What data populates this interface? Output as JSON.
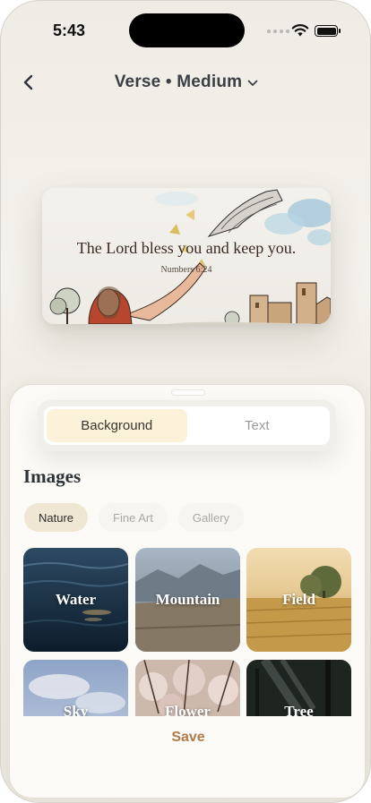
{
  "status_bar": {
    "time": "5:43"
  },
  "nav": {
    "title": "Verse • Medium",
    "back_icon": "chevron-left-icon",
    "dropdown_icon": "chevron-down-icon"
  },
  "preview": {
    "verse": "The Lord bless you and keep you.",
    "reference": "Numbers 6:24"
  },
  "sheet": {
    "tabs": [
      {
        "label": "Background",
        "active": true
      },
      {
        "label": "Text",
        "active": false
      }
    ],
    "section_title": "Images",
    "chips": [
      {
        "label": "Nature",
        "active": true
      },
      {
        "label": "Fine Art",
        "active": false
      },
      {
        "label": "Gallery",
        "active": false
      }
    ],
    "images": [
      {
        "label": "Water"
      },
      {
        "label": "Mountain"
      },
      {
        "label": "Field"
      },
      {
        "label": "Sky"
      },
      {
        "label": "Flower"
      },
      {
        "label": "Tree"
      }
    ],
    "save_label": "Save"
  },
  "colors": {
    "accent": "#b07a4b",
    "active_tab_bg": "#fbf2d9",
    "active_chip_bg": "#efe6d3"
  }
}
